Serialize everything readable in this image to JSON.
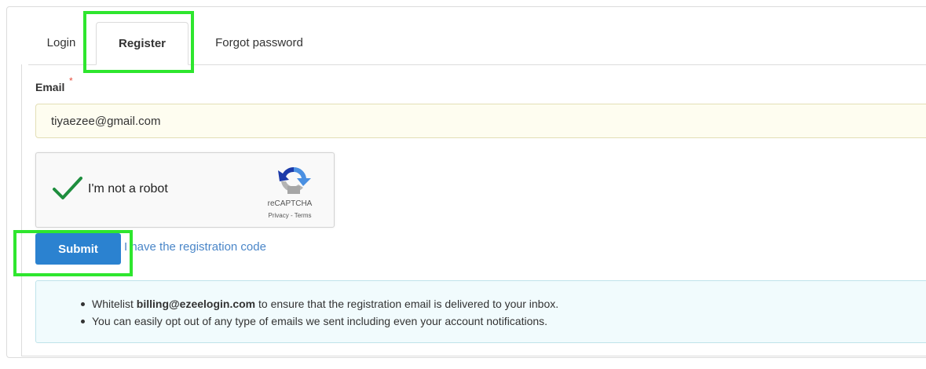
{
  "tabs": {
    "login": "Login",
    "register": "Register",
    "forgot": "Forgot password"
  },
  "form": {
    "email_label": "Email",
    "required_mark": "*",
    "email_value": "tiyaezee@gmail.com"
  },
  "recaptcha": {
    "label": "I'm not a robot",
    "brand": "reCAPTCHA",
    "privacy": "Privacy",
    "separator": " - ",
    "terms": "Terms",
    "checked": true,
    "check_color": "#1e8e3e"
  },
  "actions": {
    "submit_label": "Submit",
    "code_link": "I have the registration code"
  },
  "info": {
    "item1_prefix": "Whitelist ",
    "item1_email": "billing@ezeelogin.com",
    "item1_suffix": " to ensure that the registration email is delivered to your inbox.",
    "item2": "You can easily opt out of any type of emails we sent including even your account notifications."
  },
  "colors": {
    "primary_button": "#2b82d0",
    "link": "#4a86c8",
    "highlight": "#2ee62e",
    "input_bg": "#fefdf0",
    "info_bg": "#f1fbfd"
  }
}
